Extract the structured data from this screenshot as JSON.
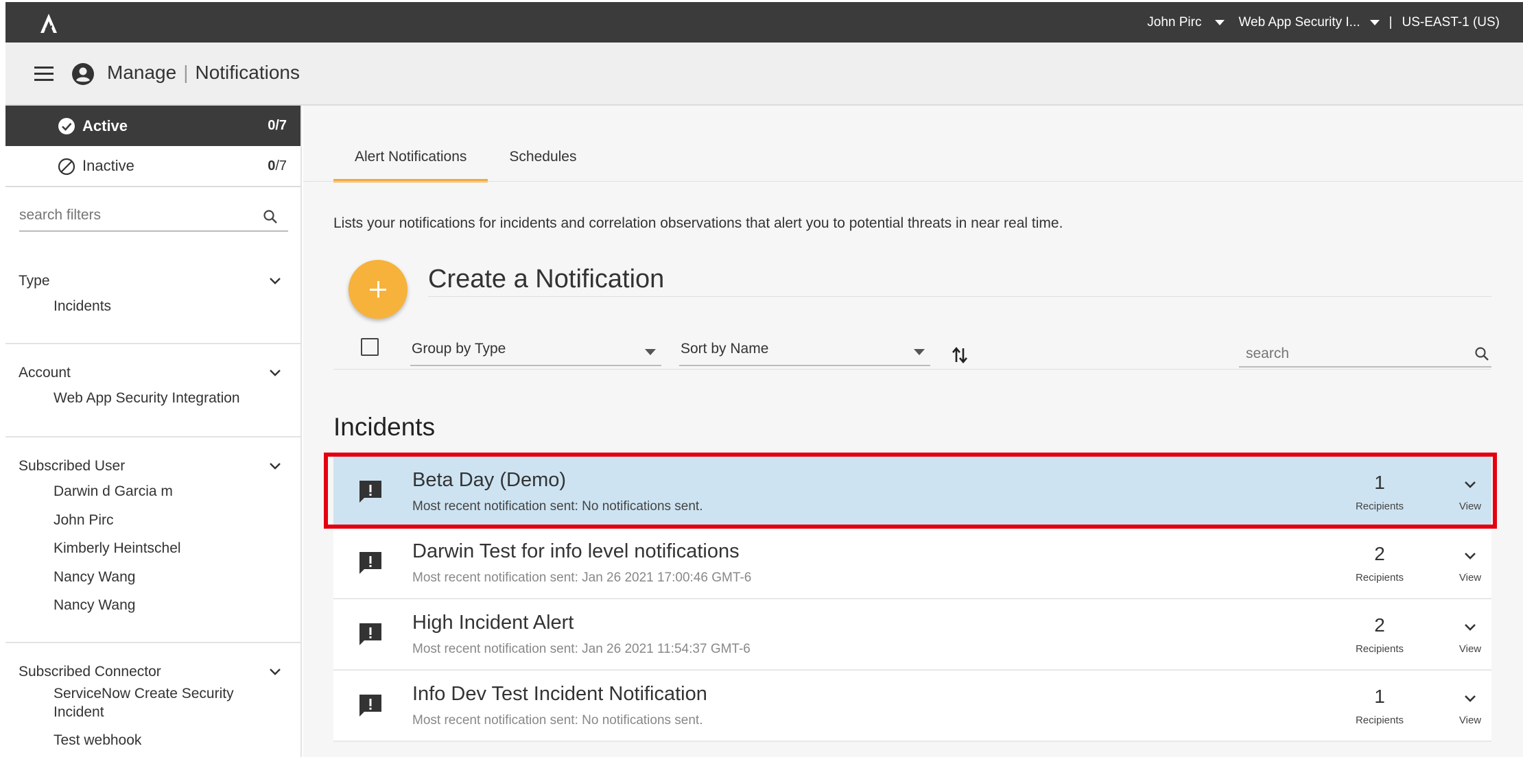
{
  "topbar": {
    "user": "John Pirc",
    "account": "Web App Security I...",
    "separator": "|",
    "region": "US-EAST-1 (US)"
  },
  "header": {
    "section": "Manage",
    "separator": "|",
    "page": "Notifications"
  },
  "sidebar": {
    "status": [
      {
        "label": "Active",
        "count_selected": "0",
        "count_total": "/7"
      },
      {
        "label": "Inactive",
        "count_selected": "0",
        "count_total": "/7"
      }
    ],
    "search_placeholder": "search filters",
    "filters": [
      {
        "title": "Type",
        "items": [
          "Incidents"
        ]
      },
      {
        "title": "Account",
        "items": [
          "Web App Security Integration"
        ]
      },
      {
        "title": "Subscribed User",
        "items": [
          "Darwin d Garcia m",
          "John Pirc",
          "Kimberly Heintschel",
          "Nancy Wang",
          "Nancy Wang"
        ]
      },
      {
        "title": "Subscribed Connector",
        "items": [
          "ServiceNow Create Security",
          "Incident",
          "Test webhook"
        ]
      }
    ]
  },
  "main": {
    "tabs": [
      "Alert Notifications",
      "Schedules"
    ],
    "description": "Lists your notifications for incidents and correlation observations that alert you to potential threats in near real time.",
    "create_label": "Create a Notification",
    "group_by": "Group by Type",
    "sort_by": "Sort by Name",
    "search_placeholder": "search",
    "section_title": "Incidents",
    "rows": [
      {
        "title": "Beta Day (Demo)",
        "subtitle": "Most recent notification sent: No notifications sent.",
        "count": "1",
        "count_label": "Recipients",
        "view": "View"
      },
      {
        "title": "Darwin Test for info level notifications",
        "subtitle": "Most recent notification sent: Jan 26 2021 17:00:46 GMT-6",
        "count": "2",
        "count_label": "Recipients",
        "view": "View"
      },
      {
        "title": "High Incident Alert",
        "subtitle": "Most recent notification sent: Jan 26 2021 11:54:37 GMT-6",
        "count": "2",
        "count_label": "Recipients",
        "view": "View"
      },
      {
        "title": "Info Dev Test Incident Notification",
        "subtitle": "Most recent notification sent: No notifications sent.",
        "count": "1",
        "count_label": "Recipients",
        "view": "View"
      }
    ]
  },
  "colors": {
    "topbar": "#3b3b3b",
    "accent": "#f7b23b",
    "highlight_row": "#cde3f1",
    "annotation": "#e4000f"
  }
}
